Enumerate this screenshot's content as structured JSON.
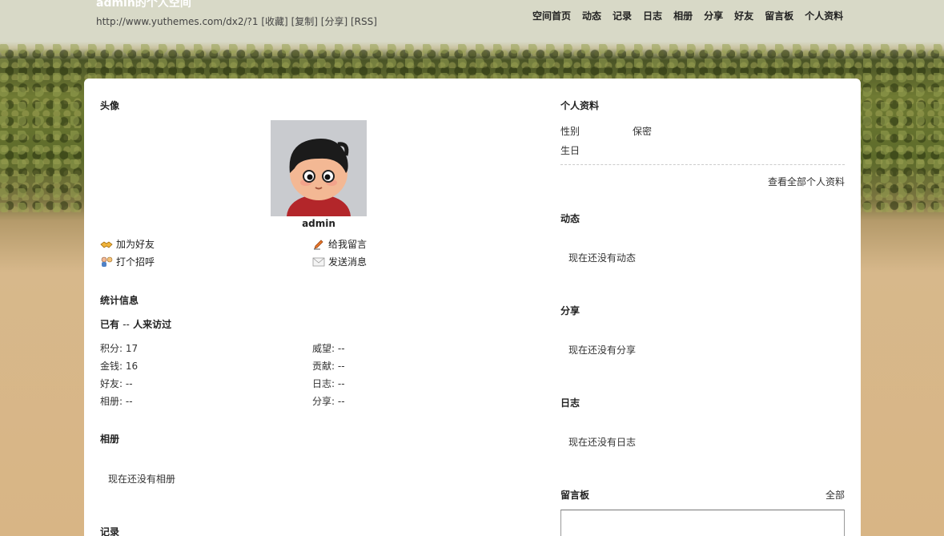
{
  "header": {
    "title": "admin的个人空间",
    "url": "http://www.yuthemes.com/dx2/?1",
    "url_actions": [
      "[收藏]",
      "[复制]",
      "[分享]",
      "[RSS]"
    ]
  },
  "nav": [
    "空间首页",
    "动态",
    "记录",
    "日志",
    "相册",
    "分享",
    "好友",
    "留言板",
    "个人资料"
  ],
  "left": {
    "avatar_title": "头像",
    "avatar_name": "admin",
    "actions": {
      "add_friend": "加为好友",
      "leave_message": "给我留言",
      "greet": "打个招呼",
      "send_message": "发送消息"
    },
    "stats_title": "统计信息",
    "visitors_prefix": "已有",
    "visitors_count": "--",
    "visitors_suffix": "人来访过",
    "stats": [
      {
        "label": "积分: 17"
      },
      {
        "label": "威望: --"
      },
      {
        "label": "金钱: 16"
      },
      {
        "label": "贡献: --"
      },
      {
        "label": "好友: --"
      },
      {
        "label": "日志: --"
      },
      {
        "label": "相册: --"
      },
      {
        "label": "分享: --"
      }
    ],
    "album_title": "相册",
    "album_empty": "现在还没有相册",
    "records_title": "记录"
  },
  "right": {
    "profile_title": "个人资料",
    "gender_label": "性别",
    "gender_value": "保密",
    "birthday_label": "生日",
    "view_all_profile": "查看全部个人资料",
    "feed_title": "动态",
    "feed_empty": "现在还没有动态",
    "share_title": "分享",
    "share_empty": "现在还没有分享",
    "blog_title": "日志",
    "blog_empty": "现在还没有日志",
    "guestbook_title": "留言板",
    "guestbook_all": "全部"
  },
  "colors": {
    "header_bg": "#d8d9c7",
    "panel_bg": "#ffffff",
    "nav_text": "#222222"
  }
}
